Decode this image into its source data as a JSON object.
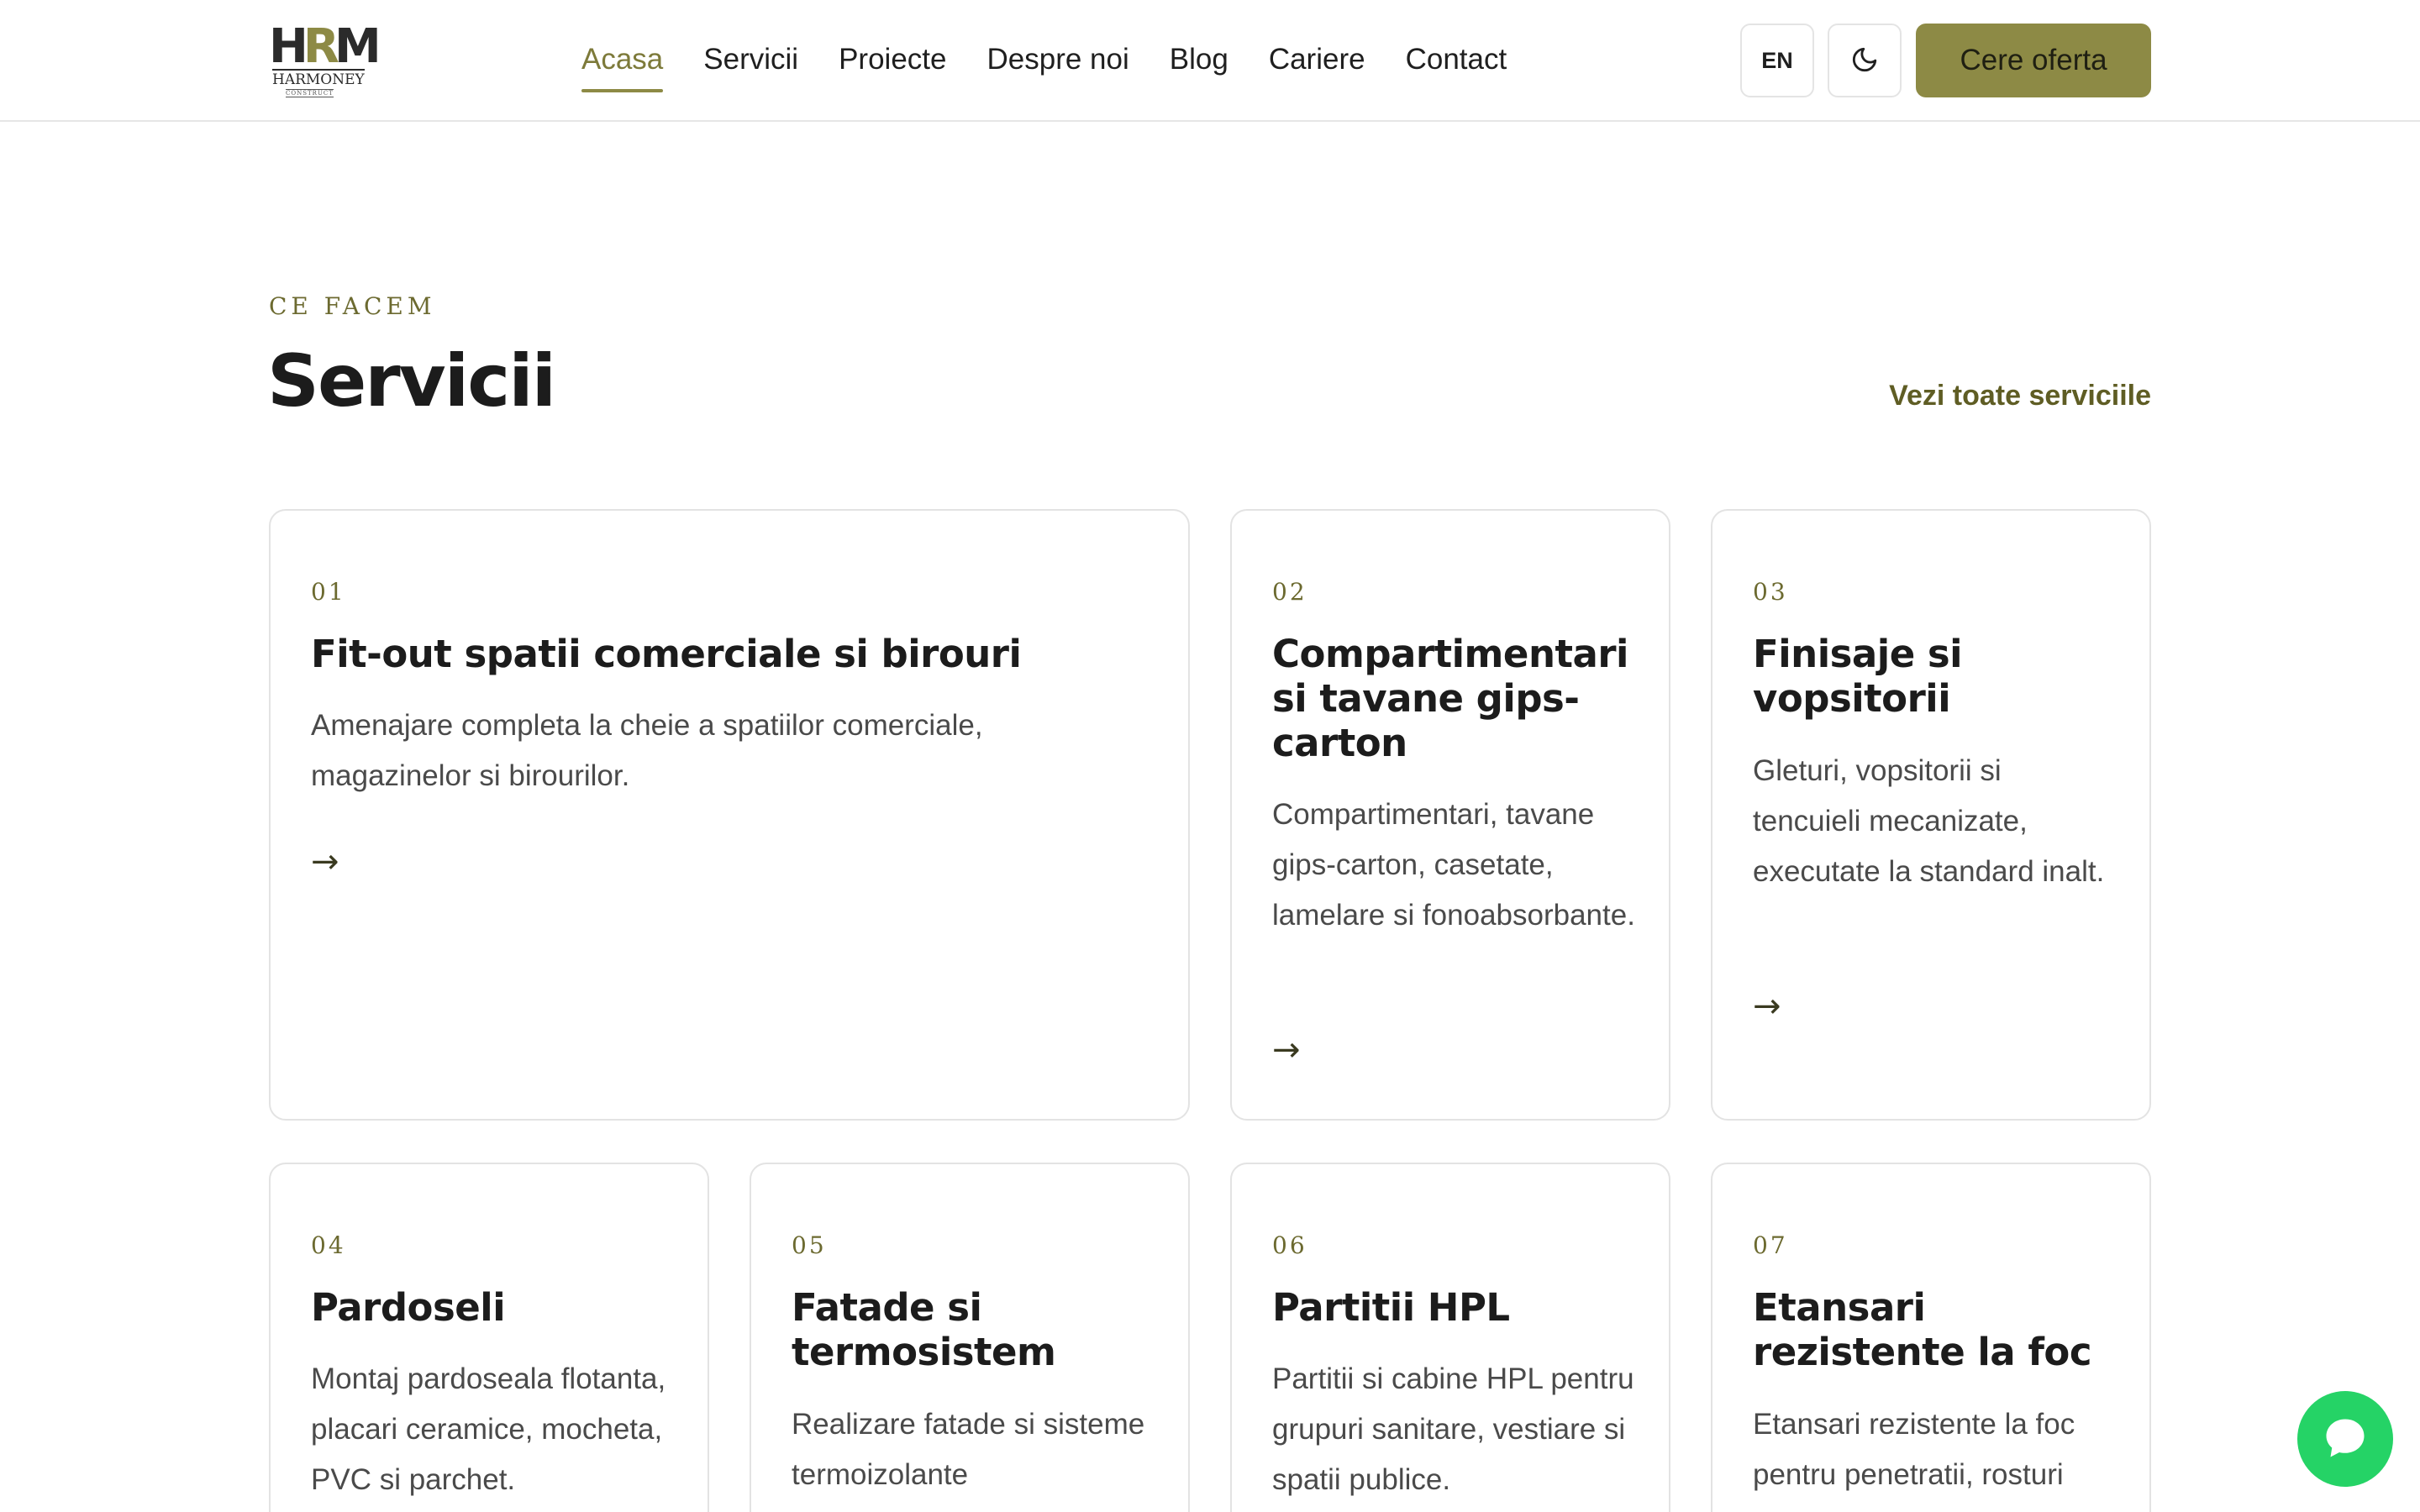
{
  "brand": {
    "logo_mark_h": "H",
    "logo_mark_r": "R",
    "logo_mark_m": "M",
    "logo_word": "HARMONEY",
    "logo_sub": "CONSTRUCT"
  },
  "nav": {
    "items": [
      {
        "label": "Acasa",
        "active": true
      },
      {
        "label": "Servicii"
      },
      {
        "label": "Proiecte"
      },
      {
        "label": "Despre noi"
      },
      {
        "label": "Blog"
      },
      {
        "label": "Cariere"
      },
      {
        "label": "Contact"
      }
    ],
    "lang_label": "EN",
    "theme_icon": "moon-icon",
    "cta_label": "Cere oferta"
  },
  "section": {
    "eyebrow": "CE FACEM",
    "title": "Servicii",
    "view_all": "Vezi toate serviciile"
  },
  "services": [
    {
      "num": "01",
      "title": "Fit-out spatii comerciale si birouri",
      "desc": "Amenajare completa la cheie a spatiilor comerciale, magazinelor si birourilor.",
      "arrow": "→"
    },
    {
      "num": "02",
      "title": "Compartimentari si tavane gips-carton",
      "desc": "Compartimentari, tavane gips-carton, casetate, lamelare si fonoabsorbante.",
      "arrow": "→"
    },
    {
      "num": "03",
      "title": "Finisaje si vopsitorii",
      "desc": "Gleturi, vopsitorii si tencuieli mecanizate, executate la standard inalt.",
      "arrow": "→"
    },
    {
      "num": "04",
      "title": "Pardoseli",
      "desc": "Montaj pardoseala flotanta, placari ceramice, mocheta, PVC si parchet.",
      "arrow": "→"
    },
    {
      "num": "05",
      "title": "Fatade si termosistem",
      "desc": "Realizare fatade si sisteme termoizolante",
      "arrow": "→"
    },
    {
      "num": "06",
      "title": "Partitii HPL",
      "desc": "Partitii si cabine HPL pentru grupuri sanitare, vestiare si spatii publice.",
      "arrow": "→"
    },
    {
      "num": "07",
      "title": "Etansari rezistente la foc",
      "desc": "Etansari rezistente la foc pentru penetratii, rosturi",
      "arrow": "→"
    }
  ],
  "colors": {
    "accent": "#8d8a45",
    "accent_text": "#6c6a30",
    "chat": "#25d366"
  },
  "chat": {
    "icon": "chat-bubble-icon"
  }
}
